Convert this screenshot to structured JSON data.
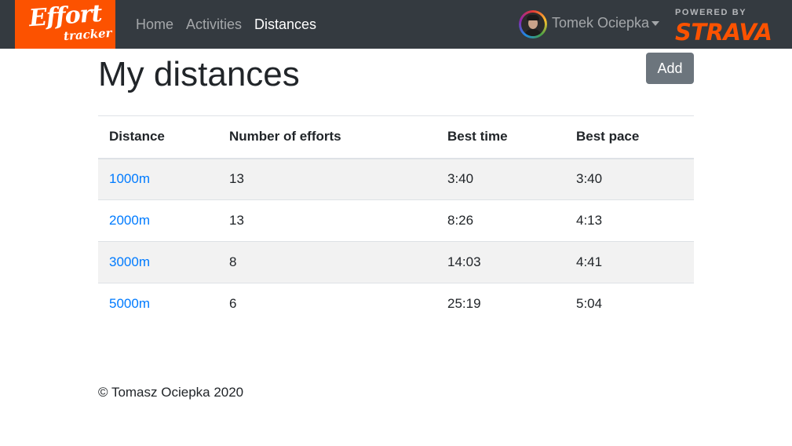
{
  "navbar": {
    "logo": {
      "main": "Effort",
      "sub": "tracker"
    },
    "links": [
      {
        "label": "Home",
        "active": false
      },
      {
        "label": "Activities",
        "active": false
      },
      {
        "label": "Distances",
        "active": true
      }
    ],
    "user": {
      "name": "Tomek Ociepka"
    },
    "powered_by": {
      "label": "POWERED BY",
      "brand": "STRAVA"
    }
  },
  "main": {
    "title": "My distances",
    "add_label": "Add",
    "table": {
      "columns": [
        "Distance",
        "Number of efforts",
        "Best time",
        "Best pace"
      ],
      "rows": [
        [
          "1000m",
          "13",
          "3:40",
          "3:40"
        ],
        [
          "2000m",
          "13",
          "8:26",
          "4:13"
        ],
        [
          "3000m",
          "8",
          "14:03",
          "4:41"
        ],
        [
          "5000m",
          "6",
          "25:19",
          "5:04"
        ]
      ]
    }
  },
  "footer": {
    "text": "© Tomasz Ociepka 2020"
  },
  "colors": {
    "navbar": "#343a40",
    "brand": "#fc5200",
    "link": "#007bff",
    "button": "#6c757d"
  }
}
